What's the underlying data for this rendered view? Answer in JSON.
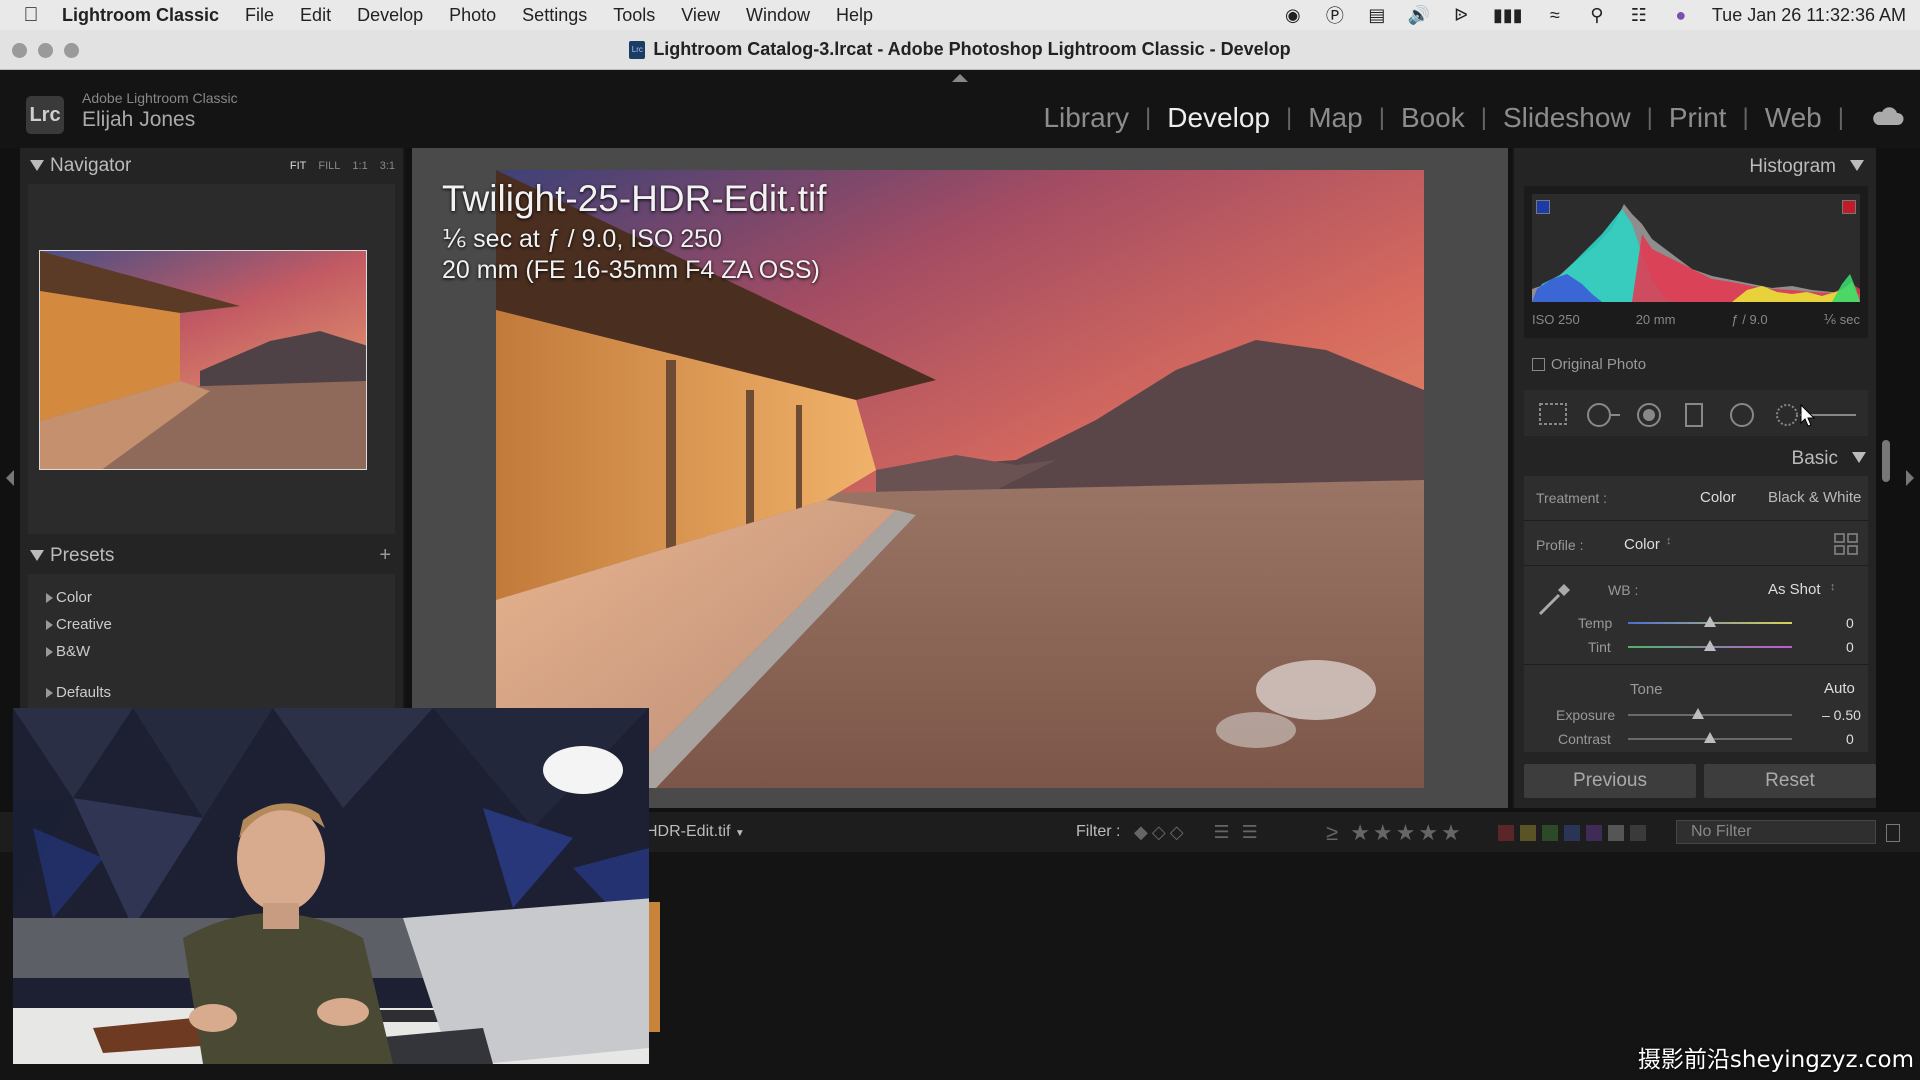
{
  "menubar": {
    "app_name": "Lightroom Classic",
    "items": [
      "File",
      "Edit",
      "Develop",
      "Photo",
      "Settings",
      "Tools",
      "View",
      "Window",
      "Help"
    ],
    "clock": "Tue Jan 26  11:32:36 AM"
  },
  "window": {
    "title": "Lightroom Catalog-3.lrcat - Adobe Photoshop Lightroom Classic - Develop"
  },
  "identity": {
    "logo": "Lrc",
    "brand": "Adobe Lightroom Classic",
    "user": "Elijah Jones"
  },
  "modules": {
    "library": "Library",
    "develop": "Develop",
    "map": "Map",
    "book": "Book",
    "slideshow": "Slideshow",
    "print": "Print",
    "web": "Web",
    "separator": "|",
    "active": "Develop"
  },
  "navigator": {
    "title": "Navigator",
    "zoom_fit": "FIT",
    "zoom_fill": "FILL",
    "zoom_1": "1:1",
    "zoom_3": "3:1"
  },
  "presets": {
    "title": "Presets",
    "add": "+",
    "items": [
      "Color",
      "Creative",
      "B&W",
      "Defaults"
    ]
  },
  "photo_info": {
    "filename": "Twilight-25-HDR-Edit.tif",
    "exposure": "⅙ sec at ƒ / 9.0, ISO 250",
    "lens": "20 mm (FE 16-35mm F4 ZA OSS)"
  },
  "histogram": {
    "title": "Histogram",
    "iso": "ISO 250",
    "focal": "20 mm",
    "aperture": "ƒ / 9.0",
    "shutter": "⅙ sec",
    "original_photo": "Original Photo"
  },
  "basic": {
    "title": "Basic",
    "treatment_label": "Treatment :",
    "treatment_color": "Color",
    "treatment_bw": "Black & White",
    "profile_label": "Profile :",
    "profile_value": "Color",
    "wb_label": "WB :",
    "wb_value": "As Shot",
    "temp_label": "Temp",
    "temp_value": "0",
    "tint_label": "Tint",
    "tint_value": "0",
    "tone_label": "Tone",
    "tone_auto": "Auto",
    "exposure_label": "Exposure",
    "exposure_value": "– 0.50",
    "contrast_label": "Contrast",
    "contrast_value": "0"
  },
  "buttons": {
    "previous": "Previous",
    "reset": "Reset"
  },
  "filmstrip": {
    "filename": "HDR-Edit.tif",
    "filter_label": "Filter :",
    "rating_prefix": "≥",
    "stars": "★★★★★",
    "filter_value": "No Filter"
  },
  "watermark": "摄影前沿sheyingzyz.com",
  "colors": {
    "accent_histogram_red": "#e8354f",
    "accent_histogram_cyan": "#2fd3c4",
    "accent_histogram_yellow": "#e8e23a"
  }
}
